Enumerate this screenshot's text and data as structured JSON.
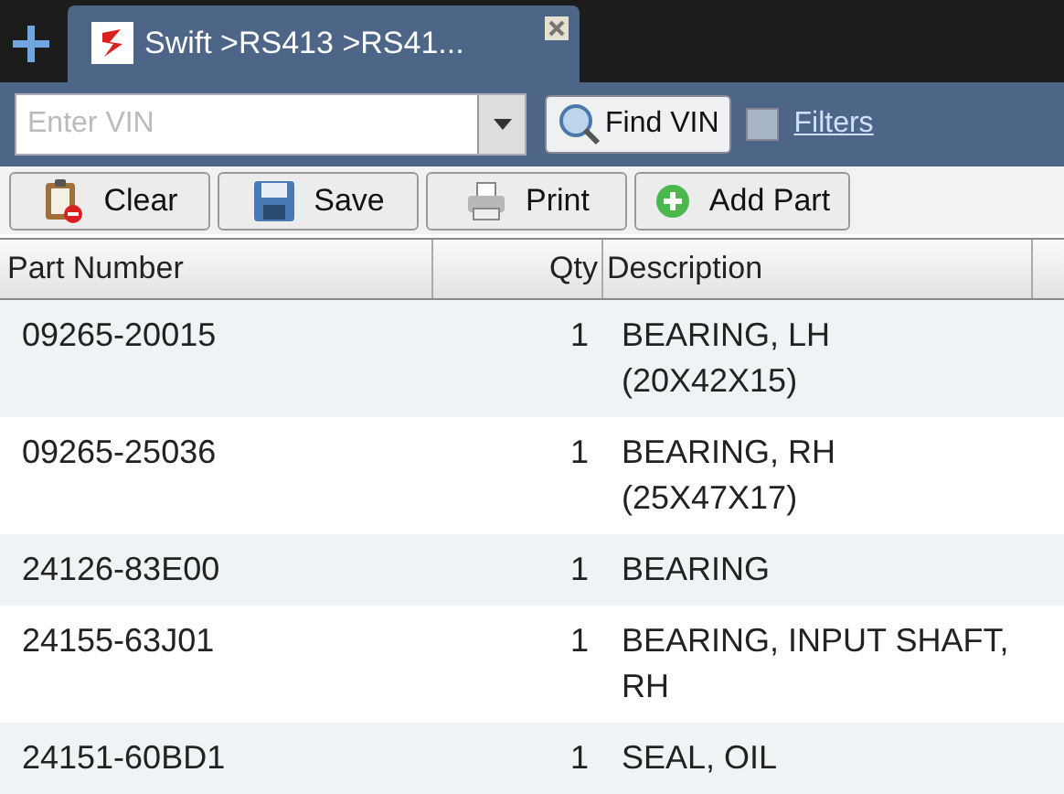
{
  "tab": {
    "title": "Swift >RS413 >RS41...",
    "selected": true
  },
  "vin": {
    "placeholder": "Enter VIN"
  },
  "find_button": "Find VIN",
  "filters": {
    "label": "Filters",
    "checked": false
  },
  "toolbar": [
    {
      "kind": "clear",
      "label": "Clear"
    },
    {
      "kind": "save",
      "label": "Save"
    },
    {
      "kind": "print",
      "label": "Print"
    },
    {
      "kind": "add",
      "label": "Add Part"
    }
  ],
  "table": {
    "columns": [
      "Part Number",
      "Qty",
      "Description"
    ],
    "rows": [
      {
        "part": "09265-20015",
        "qty": "1",
        "description": "BEARING, LH\n(20X42X15)"
      },
      {
        "part": "09265-25036",
        "qty": "1",
        "description": "BEARING, RH\n(25X47X17)"
      },
      {
        "part": "24126-83E00",
        "qty": "1",
        "description": "BEARING"
      },
      {
        "part": "24155-63J01",
        "qty": "1",
        "description": "BEARING, INPUT SHAFT,\nRH"
      },
      {
        "part": "24151-60BD1",
        "qty": "1",
        "description": "SEAL, OIL"
      }
    ]
  }
}
